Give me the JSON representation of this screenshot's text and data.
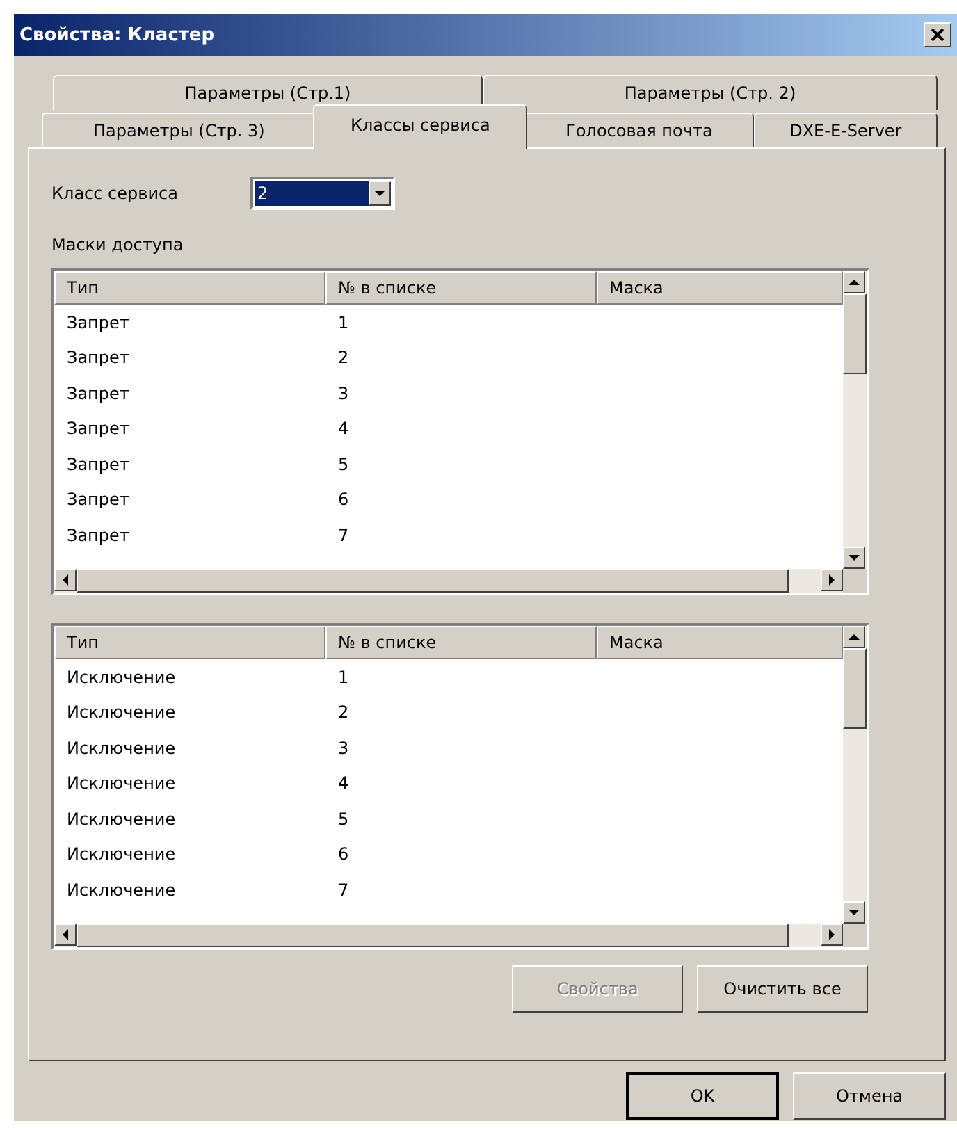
{
  "window": {
    "title": "Свойства: Кластер"
  },
  "tab_rows": [
    [
      {
        "label": "Параметры (Стр.1)",
        "selected": false
      },
      {
        "label": "Параметры (Стр. 2)",
        "selected": false
      }
    ],
    [
      {
        "label": "Параметры (Стр. 3)",
        "selected": false
      },
      {
        "label": "Классы сервиса",
        "selected": true
      },
      {
        "label": "Голосовая почта",
        "selected": false
      },
      {
        "label": "DXE-E-Server",
        "selected": false
      }
    ]
  ],
  "service_class": {
    "label": "Класс сервиса",
    "value": "2"
  },
  "access_masks_label": "Маски доступа",
  "lists": [
    {
      "columns": [
        "Тип",
        "№ в списке",
        "Маска"
      ],
      "rows": [
        [
          "Запрет",
          "1",
          ""
        ],
        [
          "Запрет",
          "2",
          ""
        ],
        [
          "Запрет",
          "3",
          ""
        ],
        [
          "Запрет",
          "4",
          ""
        ],
        [
          "Запрет",
          "5",
          ""
        ],
        [
          "Запрет",
          "6",
          ""
        ],
        [
          "Запрет",
          "7",
          ""
        ]
      ]
    },
    {
      "columns": [
        "Тип",
        "№ в списке",
        "Маска"
      ],
      "rows": [
        [
          "Исключение",
          "1",
          ""
        ],
        [
          "Исключение",
          "2",
          ""
        ],
        [
          "Исключение",
          "3",
          ""
        ],
        [
          "Исключение",
          "4",
          ""
        ],
        [
          "Исключение",
          "5",
          ""
        ],
        [
          "Исключение",
          "6",
          ""
        ],
        [
          "Исключение",
          "7",
          ""
        ]
      ]
    }
  ],
  "panel_buttons": [
    {
      "label": "Свойства",
      "disabled": true
    },
    {
      "label": "Очистить все",
      "disabled": false
    }
  ],
  "dialog_buttons": [
    {
      "label": "OK",
      "default": true
    },
    {
      "label": "Отмена",
      "default": false
    }
  ]
}
